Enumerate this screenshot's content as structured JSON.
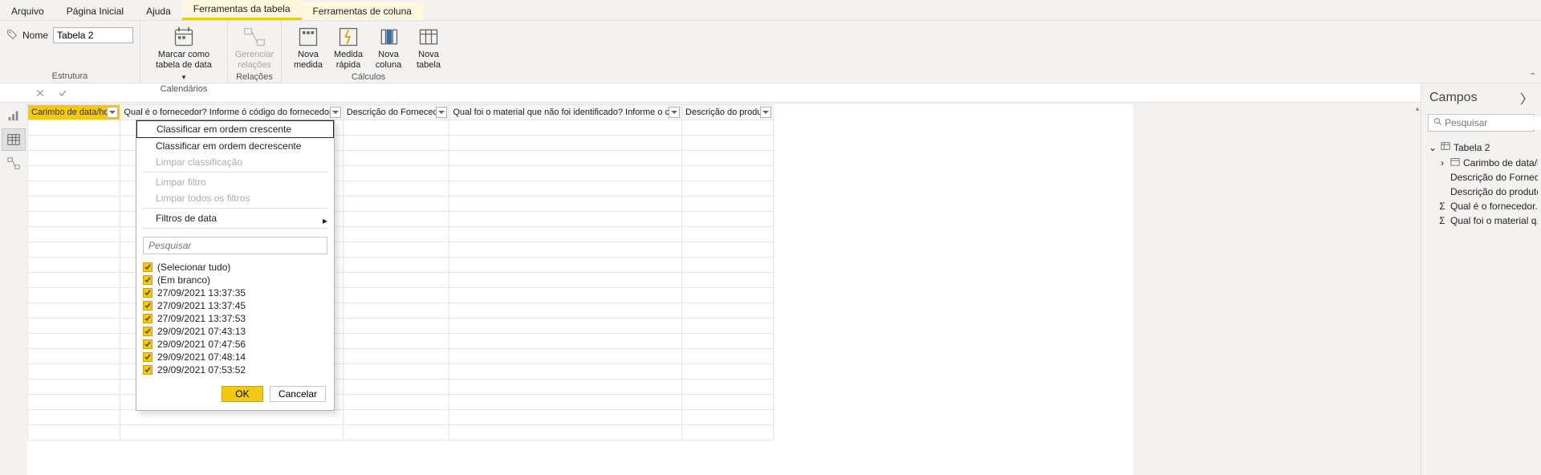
{
  "ribbon": {
    "tabs": {
      "arquivo": "Arquivo",
      "pagina": "Página Inicial",
      "ajuda": "Ajuda",
      "ferr_tabela": "Ferramentas da tabela",
      "ferr_coluna": "Ferramentas de coluna"
    },
    "estrutura": {
      "nome_label": "Nome",
      "nome_value": "Tabela 2",
      "group": "Estrutura"
    },
    "calendarios": {
      "marcar": "Marcar como tabela de data",
      "group": "Calendários"
    },
    "relacoes": {
      "gerenciar": "Gerenciar relações",
      "group": "Relações"
    },
    "calculos": {
      "nova_medida": "Nova medida",
      "medida_rapida": "Medida rápida",
      "nova_coluna": "Nova coluna",
      "nova_tabela": "Nova tabela",
      "group": "Cálculos"
    }
  },
  "table": {
    "headers": {
      "c1": "Carimbo de data/hora",
      "c2": "Qual é o fornecedor? Informe ó código do fornecedor!!!",
      "c3": "Descrição do Fornecedor",
      "c4": "Qual foi o material que não foi identificado? Informe o c…",
      "c5": "Descrição do produto"
    }
  },
  "filter_menu": {
    "sort_asc": "Classificar em ordem crescente",
    "sort_desc": "Classificar em ordem decrescente",
    "clear_sort": "Limpar classificação",
    "clear_filter": "Limpar filtro",
    "clear_all": "Limpar todos os filtros",
    "date_filters": "Filtros de data",
    "search_placeholder": "Pesquisar",
    "items": [
      "(Selecionar tudo)",
      "(Em branco)",
      "27/09/2021 13:37:35",
      "27/09/2021 13:37:45",
      "27/09/2021 13:37:53",
      "29/09/2021 07:43:13",
      "29/09/2021 07:47:56",
      "29/09/2021 07:48:14",
      "29/09/2021 07:53:52"
    ],
    "ok": "OK",
    "cancel": "Cancelar"
  },
  "fields": {
    "title": "Campos",
    "search_placeholder": "Pesquisar",
    "table_name": "Tabela 2",
    "items": {
      "carimbo": "Carimbo de data/hora",
      "desc_forn": "Descrição do Fornec...",
      "desc_prod": "Descrição do produto",
      "qual_forn": "Qual é o fornecedor...",
      "qual_mat": "Qual foi o material q..."
    }
  }
}
